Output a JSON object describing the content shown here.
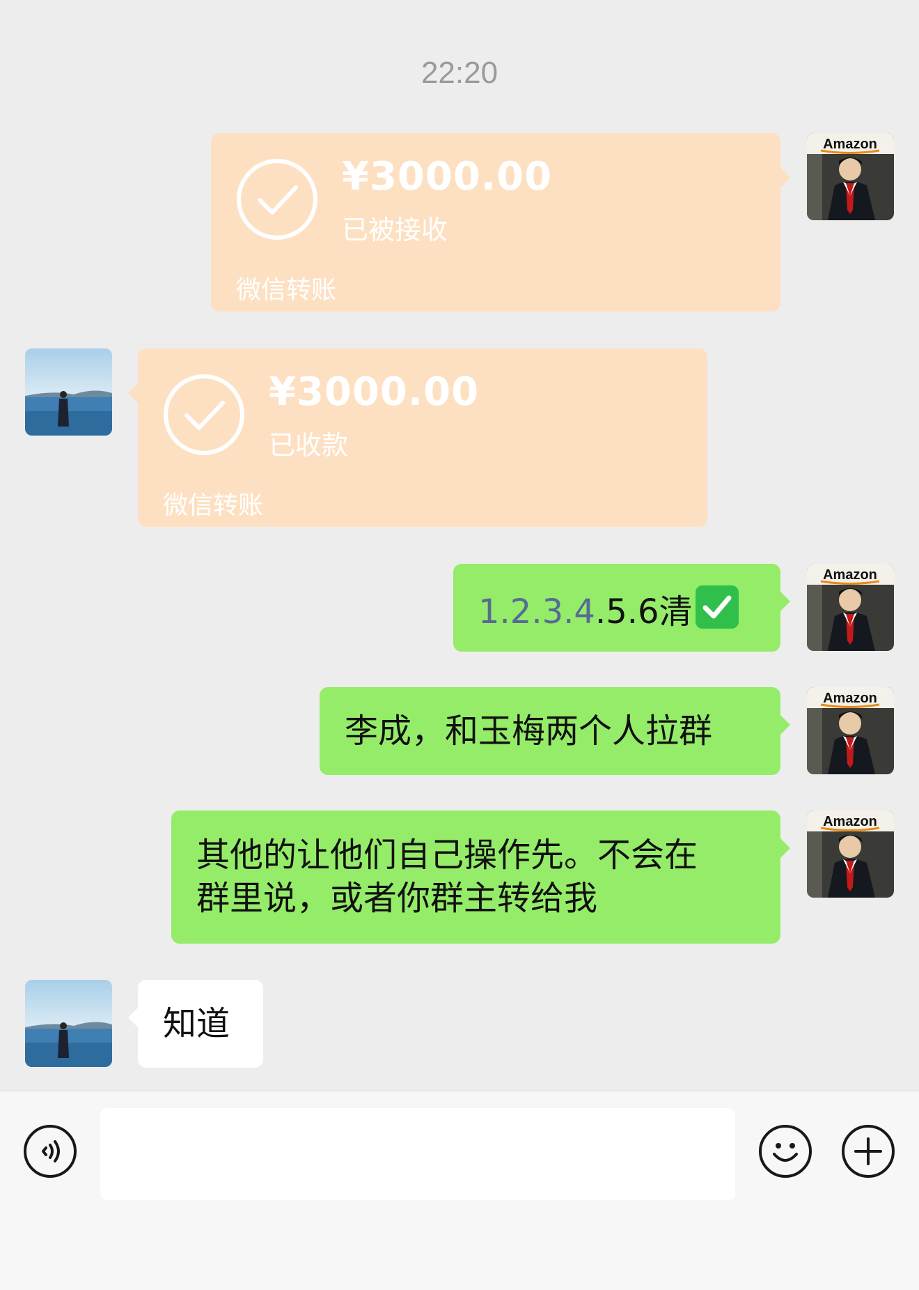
{
  "chat": {
    "timestamp": "22:20",
    "messages": [
      {
        "type": "transfer",
        "side": "right",
        "amount": "¥3000.00",
        "status": "已被接收",
        "label": "微信转账"
      },
      {
        "type": "transfer",
        "side": "left",
        "amount": "¥3000.00",
        "status": "已收款",
        "label": "微信转账"
      },
      {
        "type": "text",
        "side": "right",
        "link_part": "1.2.3.4",
        "text_part": ".5.6清"
      },
      {
        "type": "text",
        "side": "right",
        "text": "李成，和玉梅两个人拉群"
      },
      {
        "type": "text",
        "side": "right",
        "line1": "其他的让他们自己操作先。不会在",
        "line2": "群里说，或者你群主转给我"
      },
      {
        "type": "text",
        "side": "left",
        "text": "知道"
      }
    ],
    "my_avatar_text": "Amazon"
  },
  "input_bar": {
    "placeholder": "",
    "voice_icon": "voice-icon",
    "emoji_icon": "emoji-icon",
    "plus_icon": "plus-icon"
  },
  "colors": {
    "background": "#ededed",
    "transfer_card": "#fde0c2",
    "my_bubble": "#95ec69",
    "other_bubble": "#ffffff",
    "link_text": "#576b95"
  }
}
